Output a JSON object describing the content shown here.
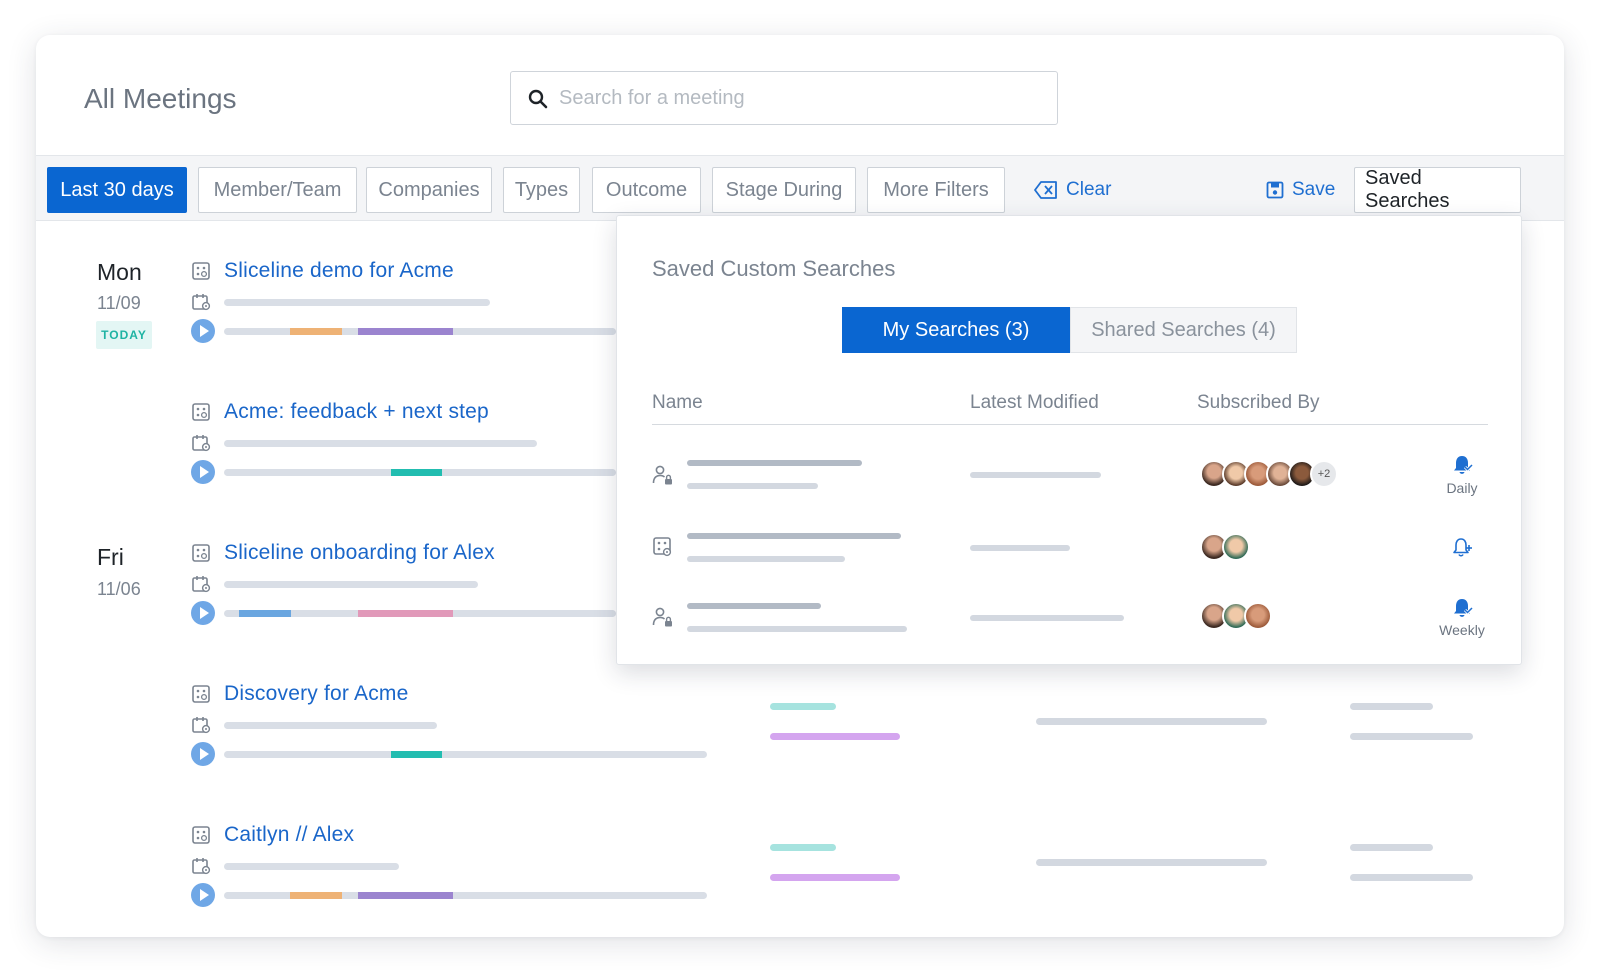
{
  "header": {
    "title": "All Meetings",
    "search_placeholder": "Search for a meeting"
  },
  "filters": {
    "date_range": "Last 30 days",
    "items": [
      "Member/Team",
      "Companies",
      "Types",
      "Outcome",
      "Stage During",
      "More Filters"
    ],
    "clear_label": "Clear",
    "save_label": "Save",
    "saved_searches_label": "Saved Searches"
  },
  "days": [
    {
      "day": "Mon",
      "date": "11/09",
      "badge": "TODAY"
    },
    {
      "day": "Fri",
      "date": "11/06"
    }
  ],
  "meetings": [
    {
      "title": "Sliceline demo for Acme"
    },
    {
      "title": "Acme: feedback + next step"
    },
    {
      "title": "Sliceline onboarding for Alex"
    },
    {
      "title": "Discovery for Acme"
    },
    {
      "title": "Caitlyn // Alex"
    }
  ],
  "saved_searches": {
    "title": "Saved Custom Searches",
    "tabs": {
      "mine": "My Searches (3)",
      "shared": "Shared Searches (4)"
    },
    "columns": {
      "name": "Name",
      "modified": "Latest Modified",
      "subscribed": "Subscribed By"
    },
    "rows": [
      {
        "type": "private",
        "extra_subscribers": "+2",
        "frequency": "Daily"
      },
      {
        "type": "meeting",
        "frequency": ""
      },
      {
        "type": "private",
        "frequency": "Weekly"
      }
    ]
  },
  "colors": {
    "primary": "#0a66d1",
    "link": "#1a66c9",
    "placeholder_bar": "#d9dee6",
    "teal": "#1fb3a3"
  }
}
